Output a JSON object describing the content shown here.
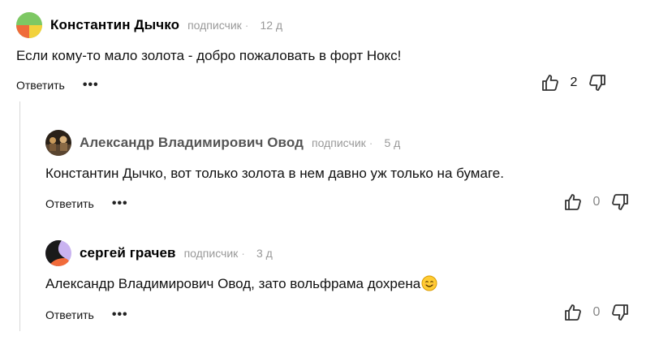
{
  "comments": [
    {
      "author": "Константин Дычко",
      "badge": "подписчик",
      "time": "12 д",
      "text": "Если кому-то мало золота - добро пожаловать в форт Нокс!",
      "reply_label": "Ответить",
      "more_label": "•••",
      "likes": "2",
      "avatar_colors": [
        "#7dc863",
        "#ef6c3a",
        "#f2d23c"
      ]
    },
    {
      "author": "Александр Владимирович Овод",
      "badge": "подписчик",
      "time": "5 д",
      "text": "Константин Дычко, вот только золота в нем давно уж только на бумаге.",
      "reply_label": "Ответить",
      "more_label": "•••",
      "likes": "0"
    },
    {
      "author": "сергей грачев",
      "badge": "подписчик",
      "time": "3 д",
      "text": "Александр Владимирович Овод, зато вольфрама дохрена",
      "reply_label": "Ответить",
      "more_label": "•••",
      "likes": "0",
      "avatar_colors": [
        "#1a1a1a",
        "#f26b3a",
        "#c9b3f0"
      ]
    }
  ],
  "icons": {
    "like": "thumbs-up-icon",
    "dislike": "thumbs-down-icon",
    "emoji": "smiling-face-emoji"
  },
  "colors": {
    "accent_vote": "#333333",
    "thread_line": "#d8d8d8"
  }
}
